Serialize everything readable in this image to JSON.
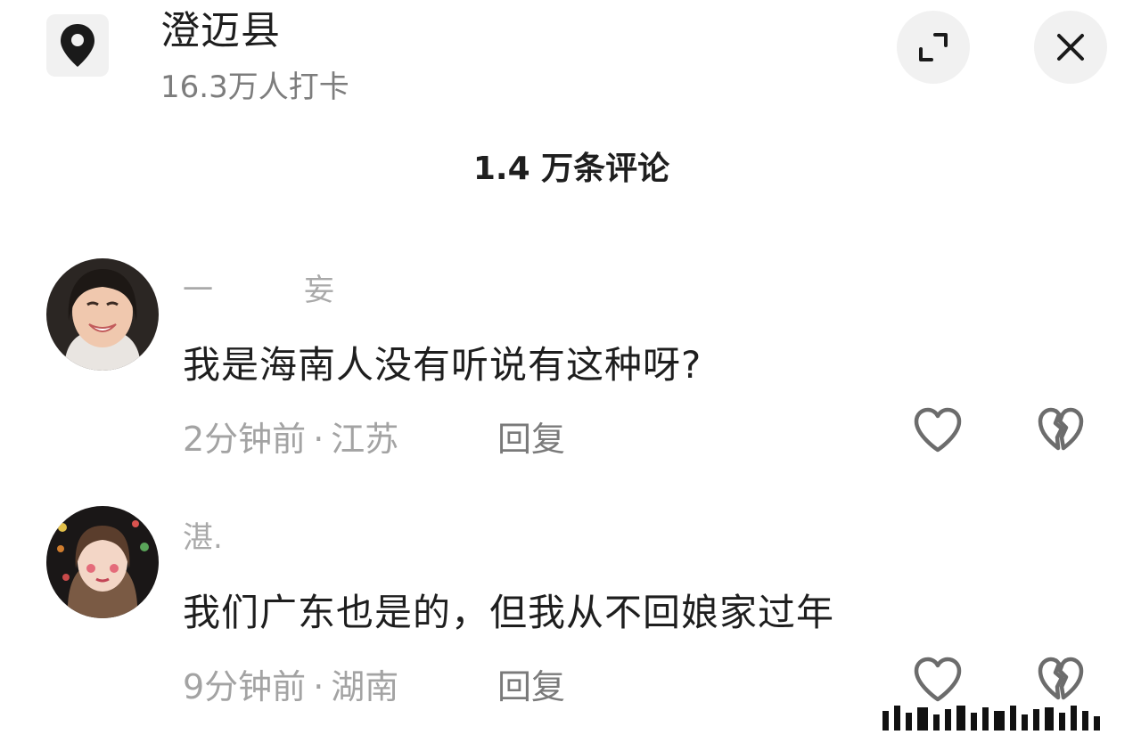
{
  "header": {
    "location_icon": "map-pin-icon",
    "title": "澄迈县",
    "checkins": "16.3万人打卡",
    "expand_icon": "expand-icon",
    "close_icon": "close-icon"
  },
  "comments_header": {
    "count_label": "1.4 万条评论"
  },
  "comments": [
    {
      "username": "一　　　妄",
      "text": "我是海南人没有听说有这种呀?",
      "time": "2分钟前",
      "separator": "·",
      "region": "江苏",
      "reply_label": "回复",
      "like_icon": "heart-icon",
      "dislike_icon": "broken-heart-icon"
    },
    {
      "username": "湛.",
      "text": "我们广东也是的，但我从不回娘家过年",
      "time": "9分钟前",
      "separator": "·",
      "region": "湖南",
      "reply_label": "回复",
      "like_icon": "heart-icon",
      "dislike_icon": "broken-heart-icon"
    }
  ],
  "colors": {
    "text_primary": "#1e1e1e",
    "text_secondary": "#a3a3a3",
    "button_bg": "#f1f1f1"
  }
}
